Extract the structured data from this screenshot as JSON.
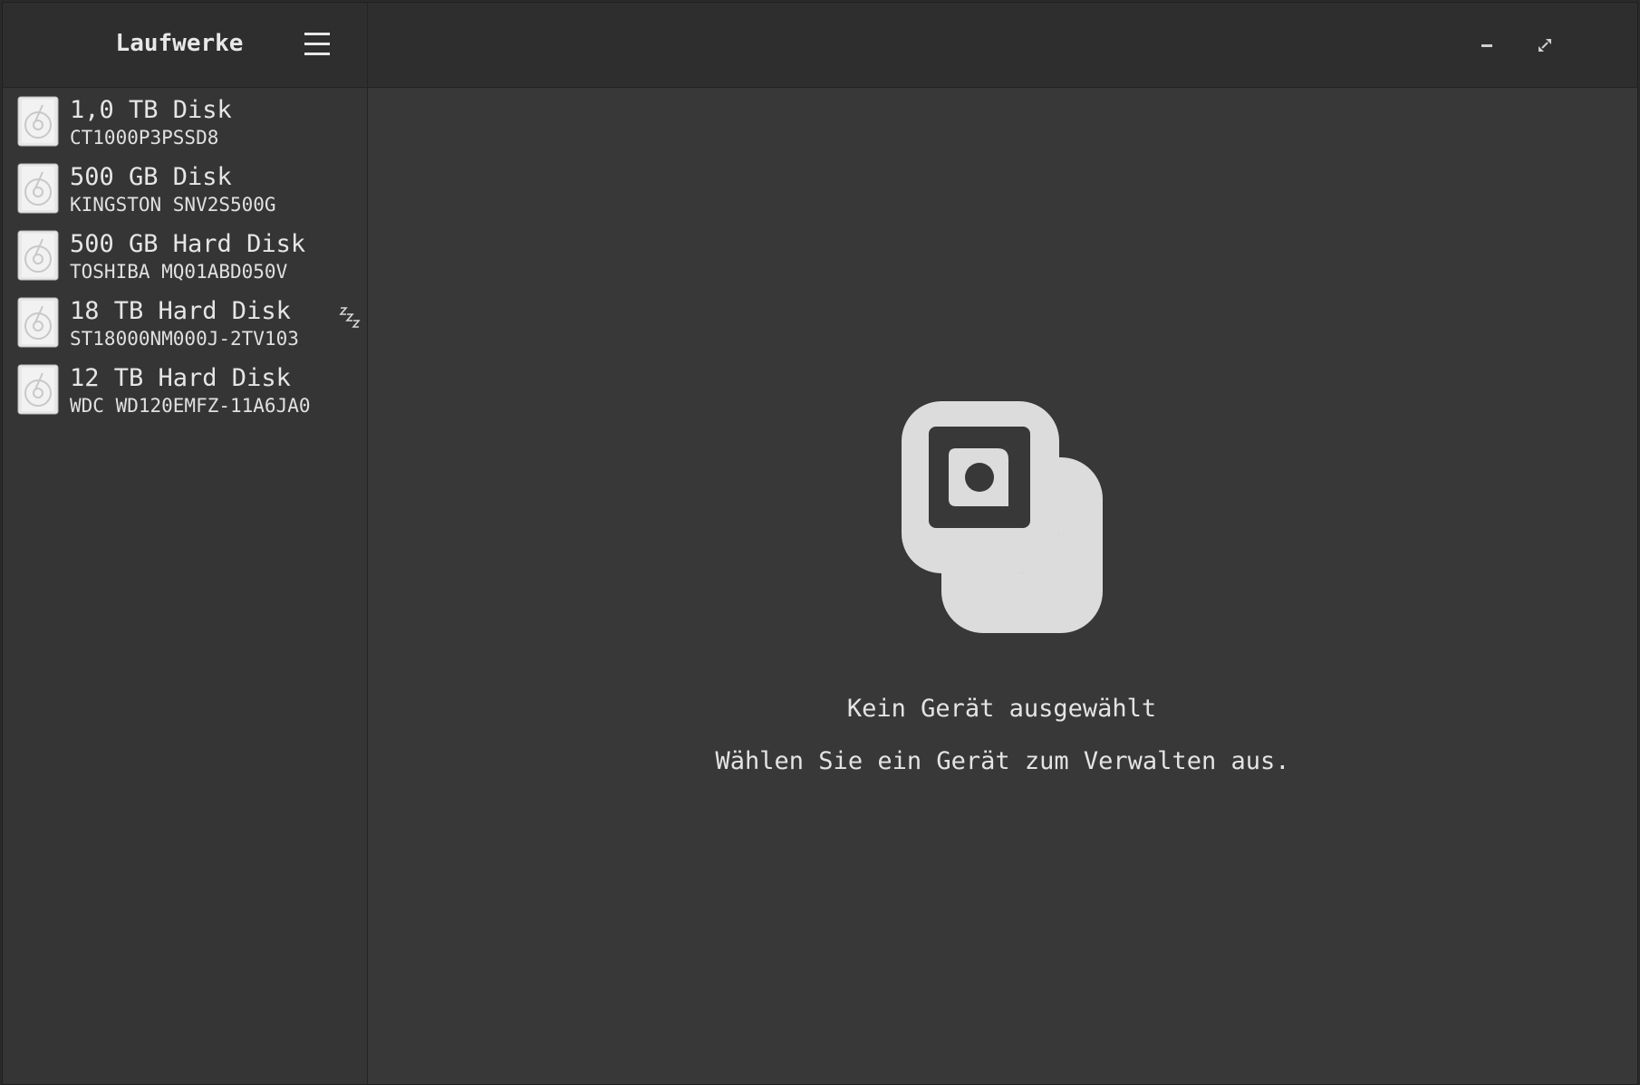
{
  "app": {
    "title": "Laufwerke"
  },
  "header": {
    "menu_icon": "hamburger-menu-icon",
    "window_controls": {
      "minimize_icon": "minimize-icon",
      "restore_icon": "restore-icon",
      "close_icon": "close-icon",
      "close_color": "#8fb172"
    }
  },
  "drives": [
    {
      "name": "1,0 TB Disk",
      "model": "CT1000P3PSSD8",
      "sleeping": false
    },
    {
      "name": "500 GB Disk",
      "model": "KINGSTON SNV2S500G",
      "sleeping": false
    },
    {
      "name": "500 GB Hard Disk",
      "model": "TOSHIBA MQ01ABD050V",
      "sleeping": false
    },
    {
      "name": "18 TB Hard Disk",
      "model": "ST18000NM000J-2TV103",
      "sleeping": true
    },
    {
      "name": "12 TB Hard Disk",
      "model": "WDC WD120EMFZ-11A6JA0",
      "sleeping": false
    }
  ],
  "empty_state": {
    "icon": "drives-placeholder-icon",
    "title": "Kein Gerät ausgewählt",
    "subtitle": "Wählen Sie ein Gerät zum Verwalten aus."
  },
  "colors": {
    "window_bg": "#383838",
    "sidebar_bg": "#353535",
    "header_bg": "#2e2e2e",
    "text": "#e6e6e6"
  }
}
